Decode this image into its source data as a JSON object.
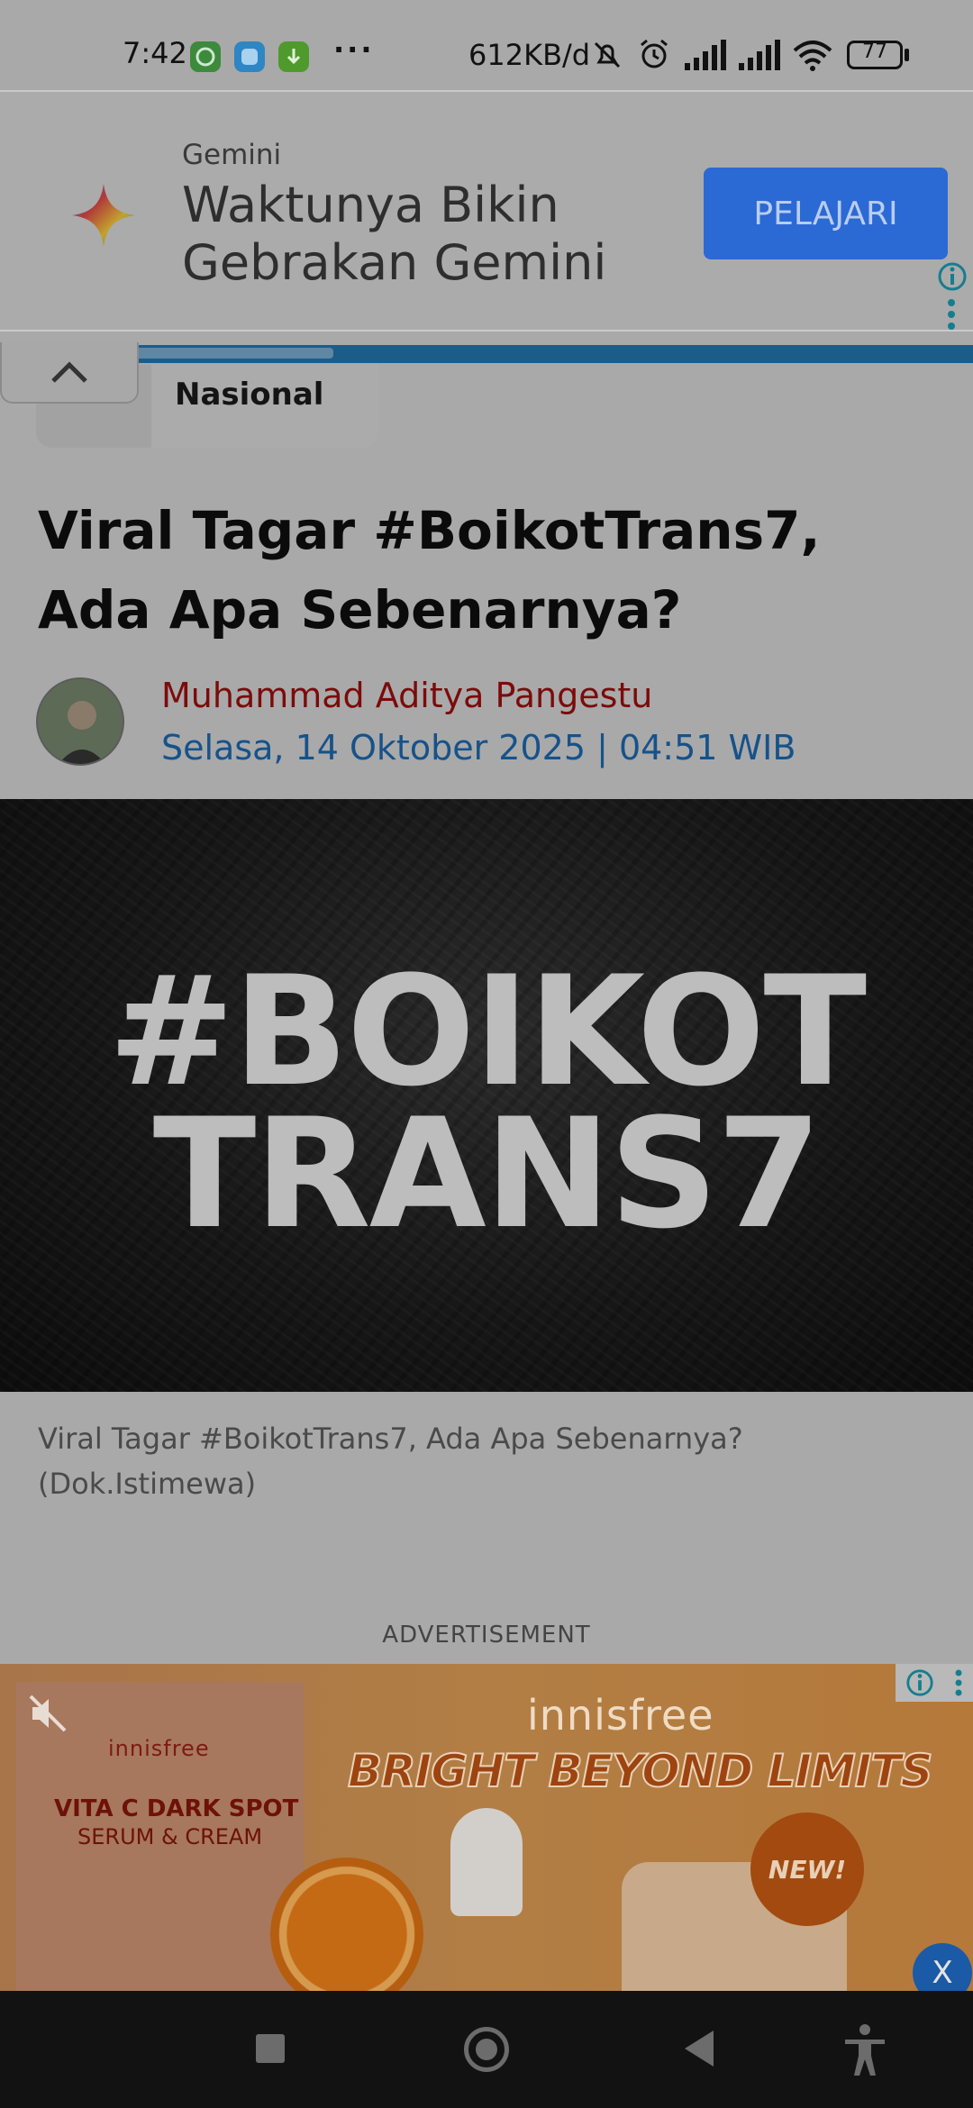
{
  "status_bar": {
    "time": "7:42",
    "more": "···",
    "net_speed": "612KB/d",
    "battery": "77",
    "icons": [
      "whatsapp-icon",
      "notification-app-icon",
      "download-icon",
      "mute-icon",
      "alarm-icon",
      "signal-icon",
      "signal-icon",
      "wifi-icon",
      "battery-icon"
    ]
  },
  "top_ad": {
    "brand": "Gemini",
    "headline": "Waktunya Bikin Gebrakan Gemini",
    "cta": "PELAJARI"
  },
  "article": {
    "category": "Nasional",
    "title": "Viral Tagar #BoikotTrans7, Ada Apa Sebenarnya?",
    "author": "Muhammad Aditya Pangestu",
    "date": "Selasa, 14 Oktober 2025 | 04:51 WIB",
    "hero_line1": "#BOIKOT",
    "hero_line2": "TRANS7",
    "caption": "Viral Tagar #BoikotTrans7, Ada Apa Sebenarnya? (Dok.Istimewa)"
  },
  "advertisement_label": "ADVERTISEMENT",
  "bottom_ad": {
    "brand_left": "innisfree",
    "product_name": "VITA C DARK SPOT",
    "product_sub": "SERUM & CREAM",
    "brand_right": "innisfree",
    "slogan": "BRIGHT BEYOND LIMITS",
    "badge": "NEW!",
    "close": "X"
  },
  "colors": {
    "cta": "#2b69d4",
    "author": "#7b0b0b",
    "date": "#16528a",
    "progress": "#1c5c89"
  }
}
